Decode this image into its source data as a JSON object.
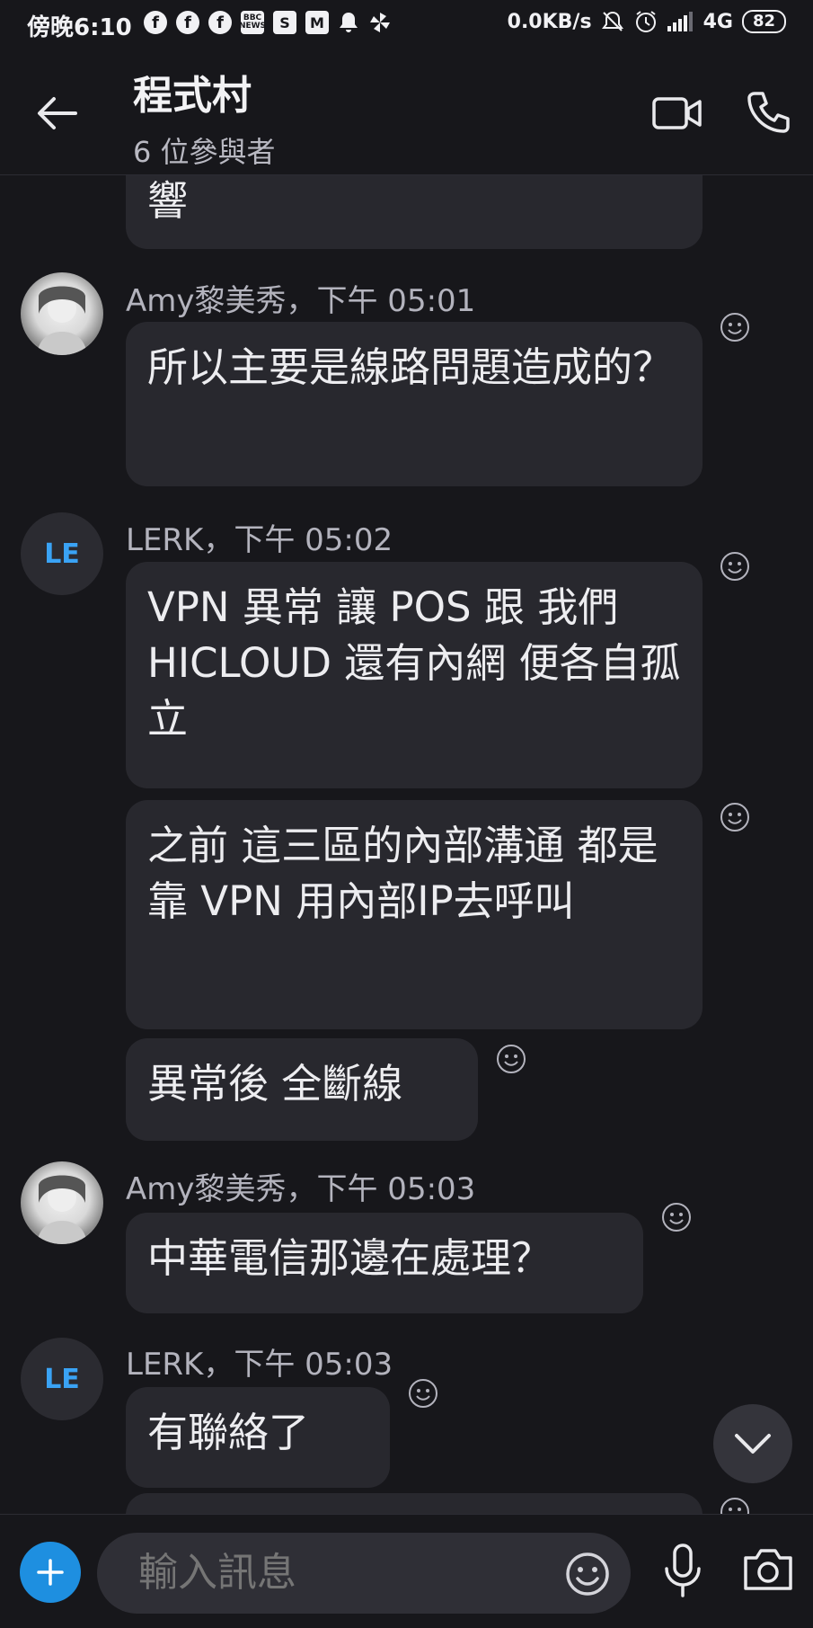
{
  "status_bar": {
    "time": "傍晚6:10",
    "network_speed": "0.0KB/s",
    "network_type": "4G",
    "battery": "82",
    "notification_icons": [
      "facebook-icon",
      "facebook-icon",
      "facebook-icon",
      "bbc-news-icon",
      "shopee-icon",
      "gmail-icon",
      "bell-icon",
      "pinwheel-icon"
    ]
  },
  "header": {
    "title": "程式村",
    "subtitle": "6 位參與者"
  },
  "messages": {
    "m0": {
      "text": "響"
    },
    "m1": {
      "sender": "Amy黎美秀，下午 05:01",
      "text": "所以主要是線路問題造成的？"
    },
    "m2": {
      "sender": "LERK，下午 05:02",
      "avatar_initials": "LE",
      "text": "VPN 異常 讓 POS  跟 我們 HICLOUD  還有內網 便各自孤立"
    },
    "m3": {
      "text": "之前 這三區的內部溝通 都是靠 VPN 用內部IP去呼叫"
    },
    "m4": {
      "text": "異常後 全斷線"
    },
    "m5": {
      "sender": "Amy黎美秀，下午 05:03",
      "text": "中華電信那邊在處理？"
    },
    "m6": {
      "sender": "LERK，下午 05:03",
      "avatar_initials": "LE",
      "text": "有聯絡了"
    }
  },
  "composer": {
    "placeholder": "輸入訊息"
  },
  "colors": {
    "background": "#17171b",
    "bubble": "#28282e",
    "accent": "#1e8fe0",
    "avatar_initials": "#3aa3f5"
  }
}
